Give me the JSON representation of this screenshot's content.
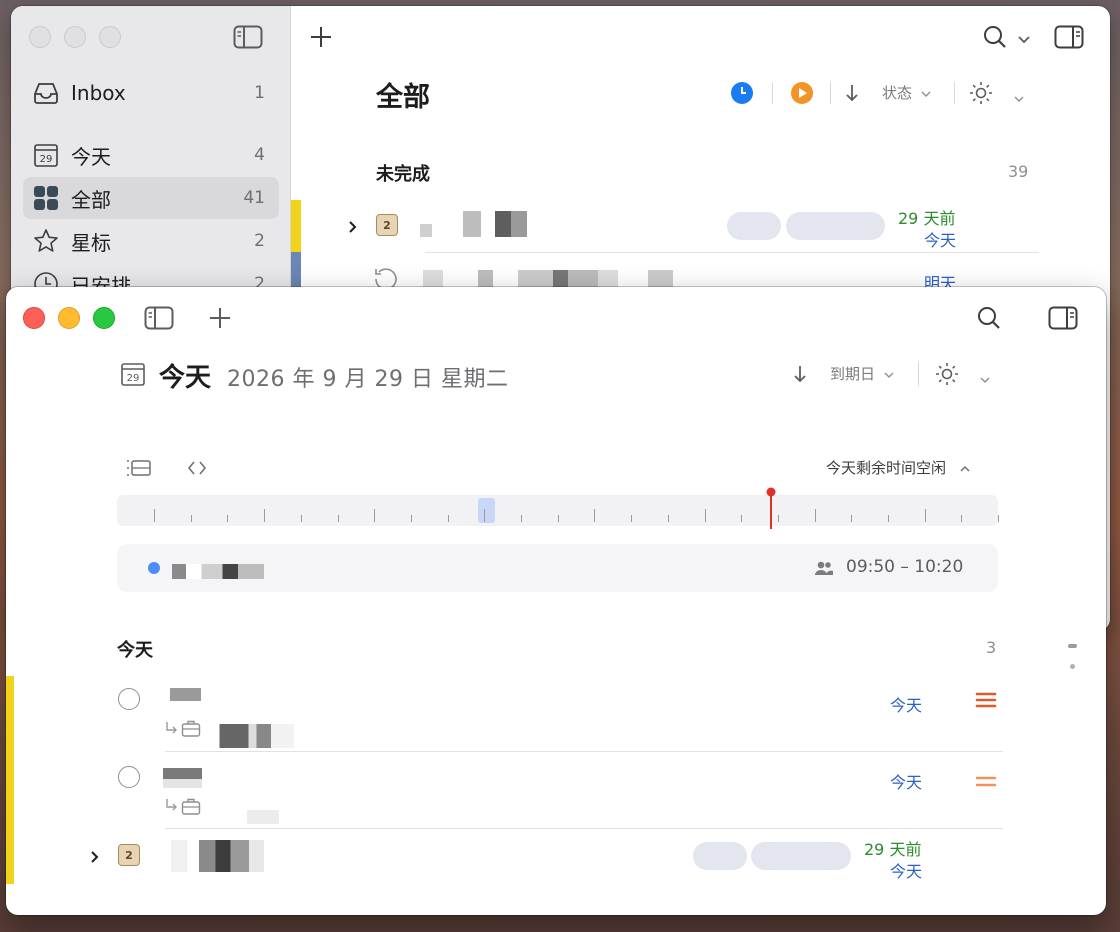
{
  "back_window": {
    "sidebar": {
      "items": [
        {
          "label": "Inbox",
          "count": "1",
          "icon": "inbox-tray-icon"
        },
        {
          "label": "今天",
          "count": "4",
          "icon": "calendar-icon",
          "day": "29"
        },
        {
          "label": "全部",
          "count": "41",
          "icon": "grid-icon",
          "selected": true
        },
        {
          "label": "星标",
          "count": "2",
          "icon": "star-icon"
        },
        {
          "label": "已安排",
          "count": "2",
          "icon": "clock-icon"
        }
      ]
    },
    "main": {
      "title": "全部",
      "sort_label": "状态",
      "section": {
        "title": "未完成",
        "count": "39"
      },
      "rows": [
        {
          "date_relative": "29 天前",
          "due": "今天"
        },
        {
          "due": "明天"
        }
      ]
    }
  },
  "front_window": {
    "header": {
      "title": "今天",
      "date": "2026 年 9 月 29 日 星期二",
      "calendar_day": "29",
      "sort_label": "到期日"
    },
    "timeline": {
      "status_label": "今天剩余时间空闲"
    },
    "event": {
      "time_range": "09:50 – 10:20",
      "dot_color": "#4c8ef7"
    },
    "section": {
      "title": "今天",
      "count": "3"
    },
    "tasks": [
      {
        "due": "今天",
        "priority": "high"
      },
      {
        "due": "今天",
        "priority": "medium"
      },
      {
        "date_relative": "29 天前",
        "due": "今天",
        "project_badge": "2"
      }
    ]
  },
  "colors": {
    "accent_blue": "#1a7cf0",
    "accent_orange": "#f39325",
    "green_text": "#2c8c2c",
    "blue_text": "#2c62c4",
    "priority_high": "#e05a2b",
    "priority_medium": "#f0935a",
    "now_marker": "#e0302c",
    "flag_yellow": "#f2d31b"
  }
}
